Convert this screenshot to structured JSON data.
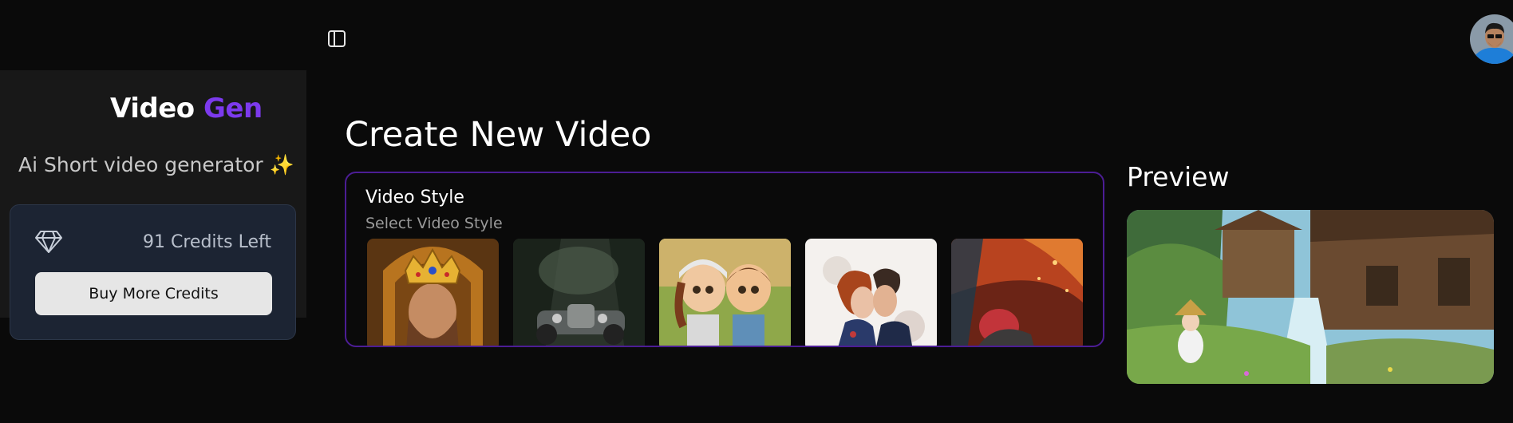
{
  "header": {
    "toggle_icon": "sidebar-toggle-icon",
    "avatar_icon": "user-avatar"
  },
  "sidebar": {
    "logo_primary": "Video",
    "logo_accent": "Gen",
    "tagline": "Ai Short video generator",
    "tagline_emoji": "✨",
    "credits": {
      "icon": "gem-icon",
      "text": "91 Credits Left",
      "button_label": "Buy More Credits"
    }
  },
  "main": {
    "title": "Create New Video",
    "video_style": {
      "heading": "Video Style",
      "subheading": "Select Video Style",
      "styles": [
        {
          "scene": "crowned king portrait"
        },
        {
          "scene": "vintage car in jungle"
        },
        {
          "scene": "cartoon children"
        },
        {
          "scene": "watercolor couple"
        },
        {
          "scene": "fantasy fire warrior"
        }
      ]
    },
    "preview": {
      "title": "Preview",
      "scene": "anime village waterfall"
    }
  },
  "colors": {
    "accent": "#7c3aed",
    "card_border": "#4c1d95",
    "background": "#0a0a0a",
    "sidebar_bg": "#181818",
    "credits_card_bg": "#1c2433"
  }
}
